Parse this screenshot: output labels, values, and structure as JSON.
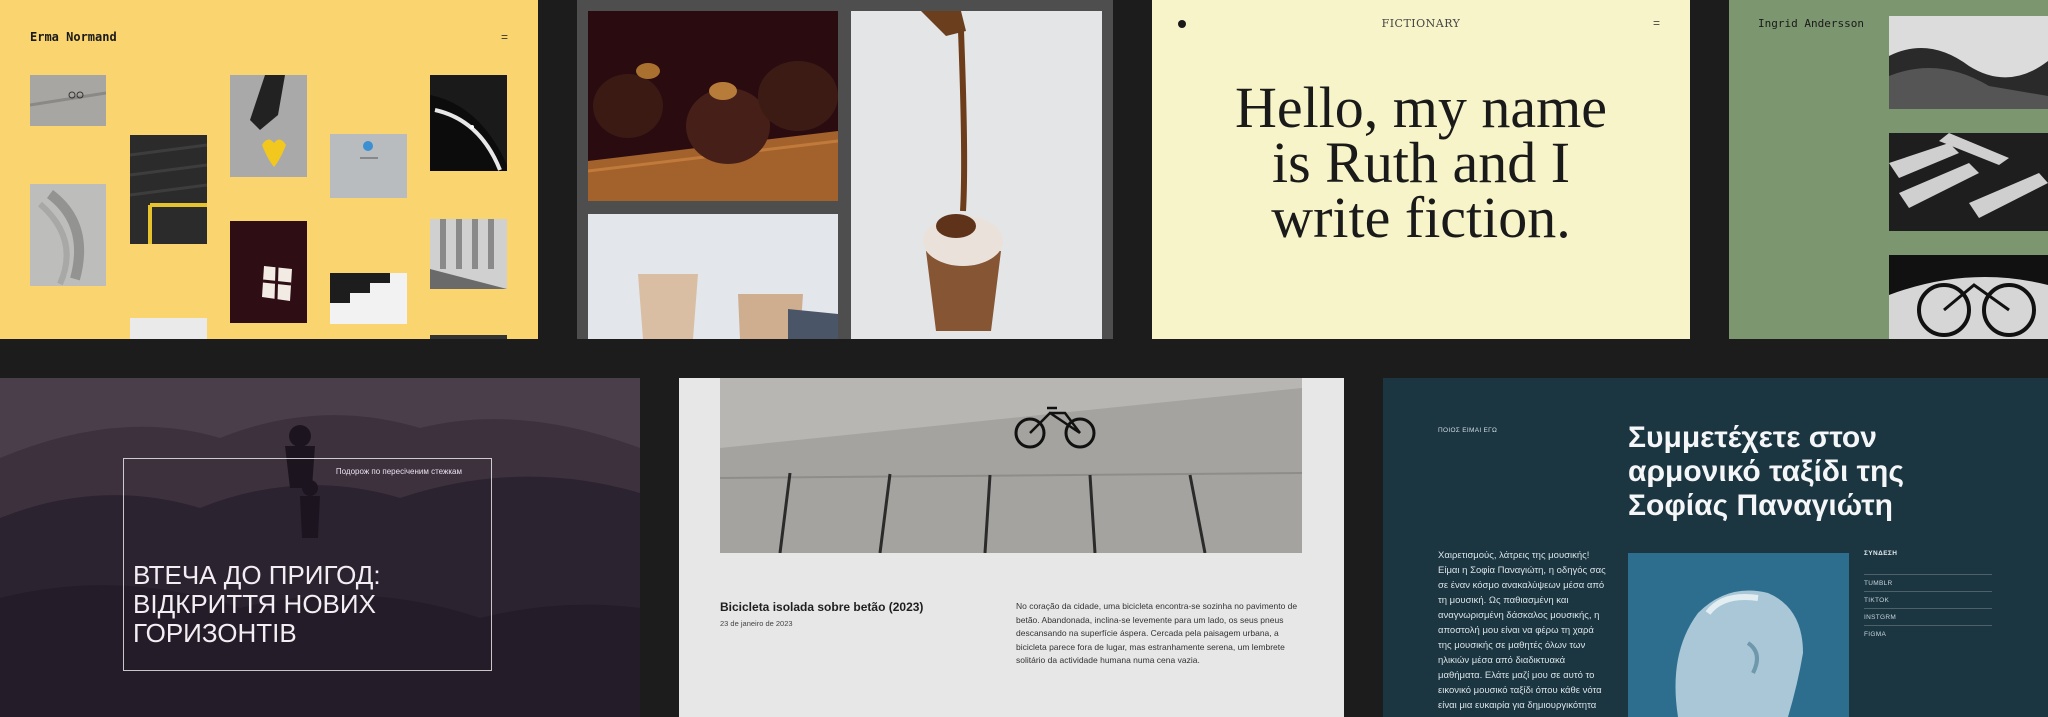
{
  "tiles": {
    "photography": {
      "author": "Erma Normand",
      "menu_icon": "="
    },
    "fictionary": {
      "brand": "FICTIONARY",
      "menu_icon": "=",
      "headline_lines": [
        "Hello, my name",
        "is Ruth and I",
        "write fiction."
      ]
    },
    "ingrid": {
      "author": "Ingrid Andersson"
    },
    "ukrainian": {
      "caption": "Подорож по пересіченим стежкам",
      "headline": "ВТЕЧА ДО ПРИГОД: ВІДКРИТТЯ НОВИХ ГОРИЗОНТІВ"
    },
    "bicicleta": {
      "title": "Bicicleta isolada sobre betão (2023)",
      "date": "23 de janeiro de 2023",
      "body": "No coração da cidade, uma bicicleta encontra-se sozinha no pavimento de betão. Abandonada, inclina-se levemente para um lado, os seus pneus descansando na superfície áspera. Cercada pela paisagem urbana, a bicicleta parece fora de lugar, mas estranhamente serena, um lembrete solitário da actividade humana numa cena vazia."
    },
    "greek": {
      "kicker": "ΠΟΙΟΣ ΕΙΜΑΙ ΕΓΩ",
      "headline": "Συμμετέχετε στον αρμονικό ταξίδι της Σοφίας Παναγιώτη",
      "body": "Χαιρετισμούς, λάτρεις της μουσικής! Είμαι η Σοφία Παναγιώτη, η οδηγός σας σε έναν κόσμο ανακαλύψεων μέσα από τη μουσική. Ως παθιασμένη και αναγνωρισμένη δάσκαλος μουσικής, η αποστολή μου είναι να φέρω τη χαρά της μουσικής σε μαθητές όλων των ηλικιών μέσα από διαδικτυακά μαθήματα. Ελάτε μαζί μου σε αυτό το εικονικό μουσικό ταξίδι όπου κάθε νότα είναι μια ευκαιρία για δημιουργικότητα και",
      "links_title": "ΣΥΝΔΕΣΗ",
      "links": [
        "TUMBLR",
        "TIKTOK",
        "INSTGRM",
        "FIGMA"
      ]
    }
  },
  "colors": {
    "background": "#1c1c1c",
    "yellow": "#fad56f",
    "cream": "#f6f4c8",
    "sage": "#7c9670",
    "plum": "#3a2f3b",
    "light_gray": "#e7e7e7",
    "teal_navy": "#1b3541"
  }
}
